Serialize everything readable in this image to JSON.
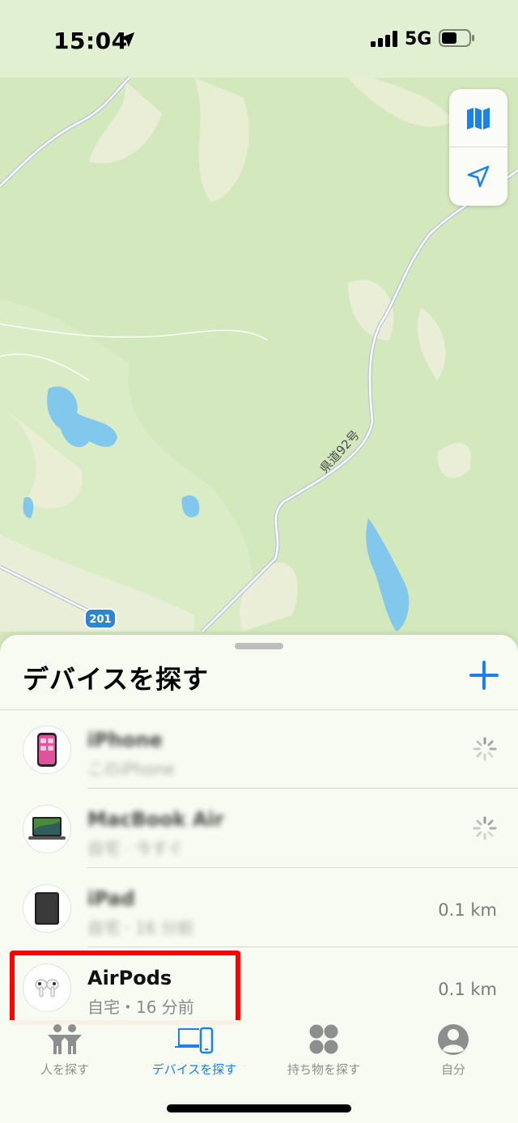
{
  "status_bar": {
    "time": "15:04",
    "network": "5G"
  },
  "map": {
    "road_label": "県道92号",
    "route_number": "201"
  },
  "sheet": {
    "title": "デバイスを探す",
    "devices": [
      {
        "name": "iPhone",
        "detail": "このiPhone",
        "distance": "",
        "icon": "iphone-icon",
        "blurred": true,
        "loading": true
      },
      {
        "name": "MacBook Air",
        "detail": "自宅 · 今すぐ",
        "distance": "",
        "icon": "macbook-icon",
        "blurred": true,
        "loading": true
      },
      {
        "name": "iPad",
        "detail": "自宅 · 16 分前",
        "distance": "0.1 km",
        "icon": "ipad-icon",
        "blurred": true,
        "loading": false
      },
      {
        "name": "AirPods",
        "detail": "自宅・16 分前",
        "distance": "0.1 km",
        "icon": "airpods-icon",
        "blurred": false,
        "loading": false
      }
    ]
  },
  "tabs": [
    {
      "label": "人を探す",
      "icon": "people-icon",
      "active": false
    },
    {
      "label": "デバイスを探す",
      "icon": "devices-icon",
      "active": true
    },
    {
      "label": "持ち物を探す",
      "icon": "items-icon",
      "active": false
    },
    {
      "label": "自分",
      "icon": "me-icon",
      "active": false
    }
  ],
  "colors": {
    "accent": "#1a80ea",
    "highlight": "#ff0000",
    "map_green": "#cfe6b4",
    "water": "#82c7ec"
  }
}
